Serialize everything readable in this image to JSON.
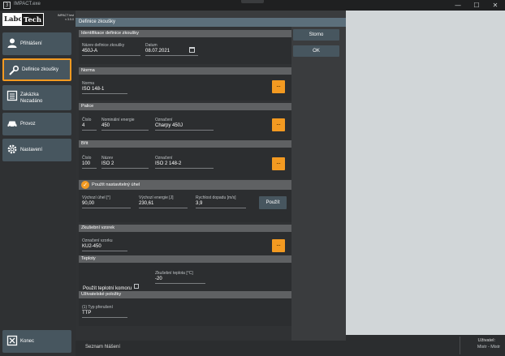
{
  "window": {
    "title": "IMPACT.exe",
    "minimize": "—",
    "maximize": "☐",
    "close": "✕"
  },
  "logo": {
    "brand1": "Labor",
    "brand2": "Tech",
    "sub1": "IMPACT test",
    "sub2": "v 3.5.0"
  },
  "sidebar": {
    "items": [
      {
        "label": "Přihlášení",
        "icon": "user-icon"
      },
      {
        "label": "Definice zkoušky",
        "icon": "wrench-icon"
      },
      {
        "label": "Zakázka\nNezadáno",
        "icon": "list-icon"
      },
      {
        "label": "Provoz",
        "icon": "car-icon"
      },
      {
        "label": "Nastavení",
        "icon": "gear-icon"
      }
    ],
    "exit_label": "Konec"
  },
  "panel": {
    "title": "Definice zkoušky",
    "cancel": "Storno",
    "ok": "OK",
    "bottom_label": "Seznam hlášení"
  },
  "sections": {
    "ident": {
      "title": "Identifikace definice zkoušky",
      "name_label": "Název definice zkoušky",
      "name_value": "450J-A",
      "date_label": "Datum",
      "date_value": "08.07.2021"
    },
    "norm": {
      "title": "Norma",
      "label": "Norma",
      "value": "ISO 148-1",
      "btn": "..."
    },
    "pendulum": {
      "title": "Palice",
      "num_label": "Číslo",
      "num_value": "4",
      "energy_label": "Nominální energie",
      "energy_value": "450",
      "mark_label": "Označení",
      "mark_value": "Charpy 450J",
      "btn": "..."
    },
    "striker": {
      "title": "Břit",
      "num_label": "Číslo",
      "num_value": "100",
      "name_label": "Název",
      "name_value": "ISO 2",
      "mark_label": "Označení",
      "mark_value": "ISO 2 148-2",
      "btn": "..."
    },
    "angle": {
      "title": "Použít nastavitelný úhel",
      "start_label": "Výchozí úhel [°]",
      "start_value": "90,00",
      "energy_label": "Výchozí energie [J]",
      "energy_value": "230,61",
      "speed_label": "Rychlost dopadu [m/s]",
      "speed_value": "3,9",
      "apply": "Použít"
    },
    "specimen": {
      "title": "Zkušební vzorek",
      "label": "Označení vzorku",
      "value": "KU2-450",
      "btn": "..."
    },
    "temps": {
      "title": "Teploty",
      "chamber_label": "Použít teplotní komoru",
      "test_temp_label": "Zkušební teplota [°C]",
      "test_temp_value": "-20"
    },
    "user": {
      "title": "Uživatelské položky",
      "label": "(1) Typ přerušení",
      "value": "TTP"
    }
  },
  "statusbar": {
    "user_label": "Uživatel:",
    "user_value": "Mistr - Mistr"
  }
}
